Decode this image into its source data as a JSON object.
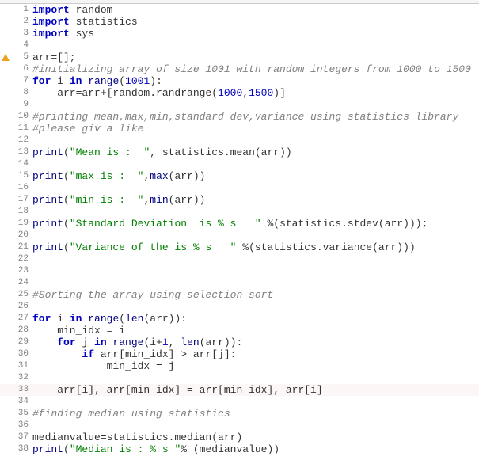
{
  "warning_line": 5,
  "highlighted_line": 33,
  "lines": [
    {
      "n": 1,
      "t": [
        [
          "kw",
          "import"
        ],
        [
          "txt",
          " random"
        ]
      ]
    },
    {
      "n": 2,
      "t": [
        [
          "kw",
          "import"
        ],
        [
          "txt",
          " statistics"
        ]
      ]
    },
    {
      "n": 3,
      "t": [
        [
          "kw",
          "import"
        ],
        [
          "txt",
          " sys"
        ]
      ]
    },
    {
      "n": 4,
      "t": []
    },
    {
      "n": 5,
      "t": [
        [
          "txt",
          "arr=[];"
        ]
      ]
    },
    {
      "n": 6,
      "t": [
        [
          "cmt",
          "#initializing array of size 1001 with random integers from 1000 to 1500"
        ]
      ]
    },
    {
      "n": 7,
      "t": [
        [
          "kw",
          "for"
        ],
        [
          "txt",
          " i "
        ],
        [
          "kw",
          "in"
        ],
        [
          "txt",
          " "
        ],
        [
          "bi",
          "range"
        ],
        [
          "txt",
          "("
        ],
        [
          "num",
          "1001"
        ],
        [
          "txt",
          "):"
        ]
      ]
    },
    {
      "n": 8,
      "t": [
        [
          "txt",
          "    arr=arr+[random.randrange("
        ],
        [
          "num",
          "1000"
        ],
        [
          "txt",
          ","
        ],
        [
          "num",
          "1500"
        ],
        [
          "txt",
          ")]"
        ]
      ]
    },
    {
      "n": 9,
      "t": []
    },
    {
      "n": 10,
      "t": [
        [
          "cmt",
          "#printing mean,max,min,standard dev,variance using statistics library"
        ]
      ]
    },
    {
      "n": 11,
      "t": [
        [
          "cmt",
          "#please giv a like"
        ]
      ]
    },
    {
      "n": 12,
      "t": []
    },
    {
      "n": 13,
      "t": [
        [
          "bi",
          "print"
        ],
        [
          "txt",
          "("
        ],
        [
          "str",
          "\"Mean is :  \""
        ],
        [
          "txt",
          ", statistics.mean(arr))"
        ]
      ]
    },
    {
      "n": 14,
      "t": []
    },
    {
      "n": 15,
      "t": [
        [
          "bi",
          "print"
        ],
        [
          "txt",
          "("
        ],
        [
          "str",
          "\"max is :  \""
        ],
        [
          "txt",
          ","
        ],
        [
          "bi",
          "max"
        ],
        [
          "txt",
          "(arr))"
        ]
      ]
    },
    {
      "n": 16,
      "t": []
    },
    {
      "n": 17,
      "t": [
        [
          "bi",
          "print"
        ],
        [
          "txt",
          "("
        ],
        [
          "str",
          "\"min is :  \""
        ],
        [
          "txt",
          ","
        ],
        [
          "bi",
          "min"
        ],
        [
          "txt",
          "(arr))"
        ]
      ]
    },
    {
      "n": 18,
      "t": []
    },
    {
      "n": 19,
      "t": [
        [
          "bi",
          "print"
        ],
        [
          "txt",
          "("
        ],
        [
          "str",
          "\"Standard Deviation  is % s   \""
        ],
        [
          "txt",
          " %(statistics.stdev(arr)));"
        ]
      ]
    },
    {
      "n": 20,
      "t": []
    },
    {
      "n": 21,
      "t": [
        [
          "bi",
          "print"
        ],
        [
          "txt",
          "("
        ],
        [
          "str",
          "\"Variance of the is % s   \""
        ],
        [
          "txt",
          " %(statistics.variance(arr)))"
        ]
      ]
    },
    {
      "n": 22,
      "t": []
    },
    {
      "n": 23,
      "t": []
    },
    {
      "n": 24,
      "t": []
    },
    {
      "n": 25,
      "t": [
        [
          "cmt",
          "#Sorting the array using selection sort"
        ]
      ]
    },
    {
      "n": 26,
      "t": []
    },
    {
      "n": 27,
      "t": [
        [
          "kw",
          "for"
        ],
        [
          "txt",
          " i "
        ],
        [
          "kw",
          "in"
        ],
        [
          "txt",
          " "
        ],
        [
          "bi",
          "range"
        ],
        [
          "txt",
          "("
        ],
        [
          "bi",
          "len"
        ],
        [
          "txt",
          "(arr)):"
        ]
      ]
    },
    {
      "n": 28,
      "t": [
        [
          "txt",
          "    min_idx = i"
        ]
      ]
    },
    {
      "n": 29,
      "t": [
        [
          "txt",
          "    "
        ],
        [
          "kw",
          "for"
        ],
        [
          "txt",
          " j "
        ],
        [
          "kw",
          "in"
        ],
        [
          "txt",
          " "
        ],
        [
          "bi",
          "range"
        ],
        [
          "txt",
          "(i+"
        ],
        [
          "num",
          "1"
        ],
        [
          "txt",
          ", "
        ],
        [
          "bi",
          "len"
        ],
        [
          "txt",
          "(arr)):"
        ]
      ]
    },
    {
      "n": 30,
      "t": [
        [
          "txt",
          "        "
        ],
        [
          "kw",
          "if"
        ],
        [
          "txt",
          " arr[min_idx] > arr[j]:"
        ]
      ]
    },
    {
      "n": 31,
      "t": [
        [
          "txt",
          "            min_idx = j"
        ]
      ]
    },
    {
      "n": 32,
      "t": []
    },
    {
      "n": 33,
      "t": [
        [
          "txt",
          "    arr[i], arr[min_idx] = arr[min_idx], arr[i]"
        ]
      ]
    },
    {
      "n": 34,
      "t": []
    },
    {
      "n": 35,
      "t": [
        [
          "cmt",
          "#finding median using statistics"
        ]
      ]
    },
    {
      "n": 36,
      "t": []
    },
    {
      "n": 37,
      "t": [
        [
          "txt",
          "medianvalue=statistics.median(arr)"
        ]
      ]
    },
    {
      "n": 38,
      "t": [
        [
          "bi",
          "print"
        ],
        [
          "txt",
          "("
        ],
        [
          "str",
          "\"Median is : % s \""
        ],
        [
          "txt",
          "% (medianvalue))"
        ]
      ]
    }
  ]
}
